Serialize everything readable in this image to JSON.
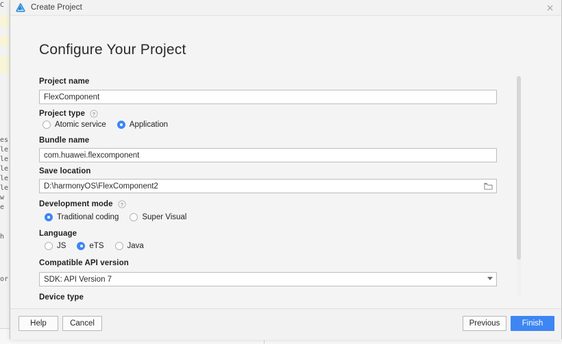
{
  "background": {
    "fragments": [
      "C",
      "es",
      "le",
      "le",
      "le",
      "le",
      "le",
      "w",
      "e",
      "h",
      "or"
    ],
    "bottom_tick": "|",
    "highlight_color": "#f7f4d8",
    "mark_color": "#efe9ae"
  },
  "window": {
    "title": "Create Project",
    "logo_icon": "deveco-logo-icon",
    "close_icon": "close-icon"
  },
  "page": {
    "title": "Configure Your Project"
  },
  "fields": {
    "project_name": {
      "label": "Project name",
      "value": "FlexComponent",
      "placeholder": "Project name"
    },
    "project_type": {
      "label": "Project type",
      "help_icon": "help-icon",
      "options": [
        {
          "label": "Atomic service",
          "selected": false
        },
        {
          "label": "Application",
          "selected": true
        }
      ]
    },
    "bundle_name": {
      "label": "Bundle name",
      "value": "com.huawei.flexcomponent",
      "placeholder": "Bundle name"
    },
    "save_location": {
      "label": "Save location",
      "value": "D:\\harmonyOS\\FlexComponent2",
      "placeholder": "Save location",
      "browse_icon": "folder-icon"
    },
    "development_mode": {
      "label": "Development mode",
      "help_icon": "help-icon",
      "options": [
        {
          "label": "Traditional coding",
          "selected": true
        },
        {
          "label": "Super Visual",
          "selected": false
        }
      ]
    },
    "language": {
      "label": "Language",
      "options": [
        {
          "label": "JS",
          "selected": false
        },
        {
          "label": "eTS",
          "selected": true
        },
        {
          "label": "Java",
          "selected": false
        }
      ]
    },
    "compatible_api_version": {
      "label": "Compatible API version",
      "value": "SDK: API Version 7",
      "dropdown_icon": "chevron-down-icon"
    },
    "device_type": {
      "label": "Device type"
    }
  },
  "footer": {
    "help": "Help",
    "cancel": "Cancel",
    "previous": "Previous",
    "finish": "Finish"
  },
  "colors": {
    "accent": "#3d86f4",
    "dialog_bg": "#f4f4f4",
    "titlebar_bg": "#f2f2f2",
    "border": "#bdbdbd"
  }
}
